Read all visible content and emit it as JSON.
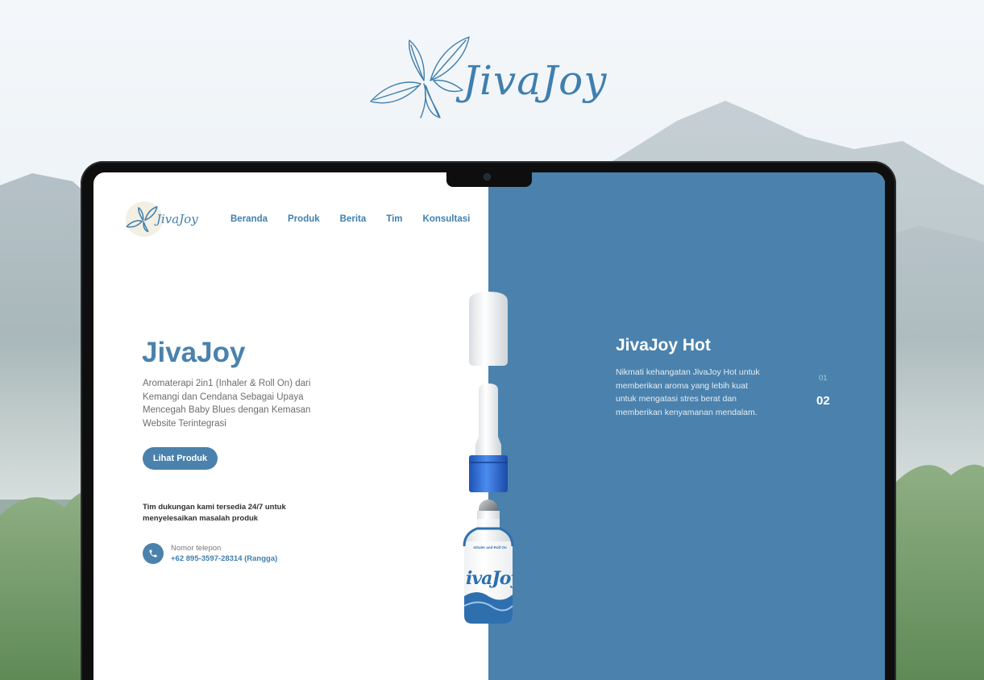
{
  "brand": {
    "name": "JivaJoy"
  },
  "site": {
    "logo_name": "JivaJoy",
    "nav": [
      "Beranda",
      "Produk",
      "Berita",
      "Tim",
      "Konsultasi"
    ]
  },
  "hero": {
    "title": "JivaJoy",
    "description": "Aromaterapi 2in1 (Inhaler & Roll On) dari Kemangi dan Cendana Sebagai Upaya Mencegah Baby Blues dengan Kemasan Website Terintegrasi",
    "cta_label": "Lihat Produk"
  },
  "support": {
    "text": "Tim dukungan kami tersedia 24/7 untuk menyelesaikan masalah produk",
    "phone_label": "Nomor telepon",
    "phone_number": "+62 895-3597-28314 (Rangga)"
  },
  "product": {
    "title": "JivaJoy Hot",
    "description": "Nikmati kehangatan JivaJoy Hot untuk memberikan aroma yang lebih kuat untuk mengatasi stres berat dan memberikan kenyamanan mendalam.",
    "pager": {
      "prev": "01",
      "current": "02"
    },
    "bottle_label": "ivaJoy",
    "bottle_top_label": "Inhaler and Roll On"
  },
  "colors": {
    "accent": "#4a82ad",
    "brand_text": "#3f7fae",
    "bottle_cap_blue": "#2f6fd0"
  },
  "icons": [
    "basil-leaf-logo-icon",
    "phone-icon",
    "laptop-camera-icon"
  ]
}
